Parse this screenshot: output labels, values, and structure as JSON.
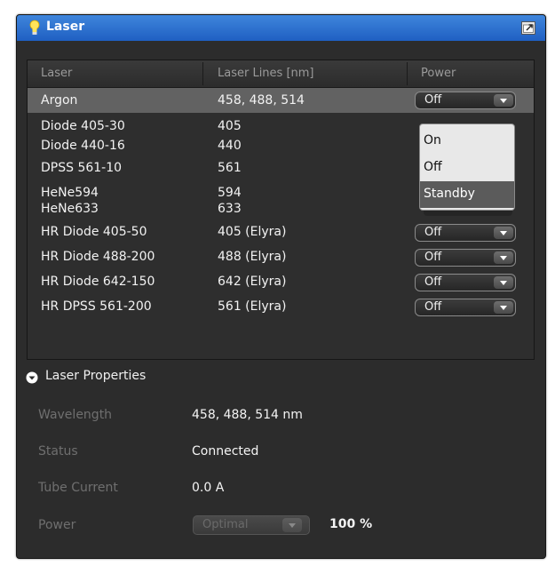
{
  "window": {
    "title": "Laser"
  },
  "colors": {
    "titlebar": "#2b73d4",
    "panel": "#2c2c2c",
    "selected_row": "#626262"
  },
  "icons": {
    "title": "lightbulb-icon",
    "undock": "undock-icon",
    "section": "collapse-circle-icon",
    "dropdown": "chevron-down-icon"
  },
  "table": {
    "headers": {
      "laser": "Laser",
      "lines": "Laser Lines [nm]",
      "power": "Power"
    },
    "rows": [
      {
        "name": "Argon",
        "lines": "458, 488, 514",
        "power": "Off",
        "selected": true
      },
      {
        "name": "Diode 405-30",
        "lines": "405"
      },
      {
        "name": "Diode 440-16",
        "lines": "440"
      },
      {
        "name": "DPSS 561-10",
        "lines": "561"
      },
      {
        "name": "HeNe594",
        "lines": "594"
      },
      {
        "name": "HeNe633",
        "lines": "633"
      },
      {
        "name": "HR Diode 405-50",
        "lines": "405 (Elyra)",
        "power": "Off"
      },
      {
        "name": "HR Diode 488-200",
        "lines": "488 (Elyra)",
        "power": "Off"
      },
      {
        "name": "HR Diode 642-150",
        "lines": "642 (Elyra)",
        "power": "Off"
      },
      {
        "name": "HR DPSS 561-200",
        "lines": "561 (Elyra)",
        "power": "Off"
      }
    ]
  },
  "power_menu": {
    "options": [
      "On",
      "Off",
      "Standby"
    ],
    "highlighted": "Standby"
  },
  "properties": {
    "title": "Laser Properties",
    "wavelength_label": "Wavelength",
    "wavelength_value": "458, 488, 514 nm",
    "status_label": "Status",
    "status_value": "Connected",
    "tube_current_label": "Tube Current",
    "tube_current_value": "0.0 A",
    "power_label": "Power",
    "power_mode": "Optimal",
    "power_percent": "100 %"
  }
}
